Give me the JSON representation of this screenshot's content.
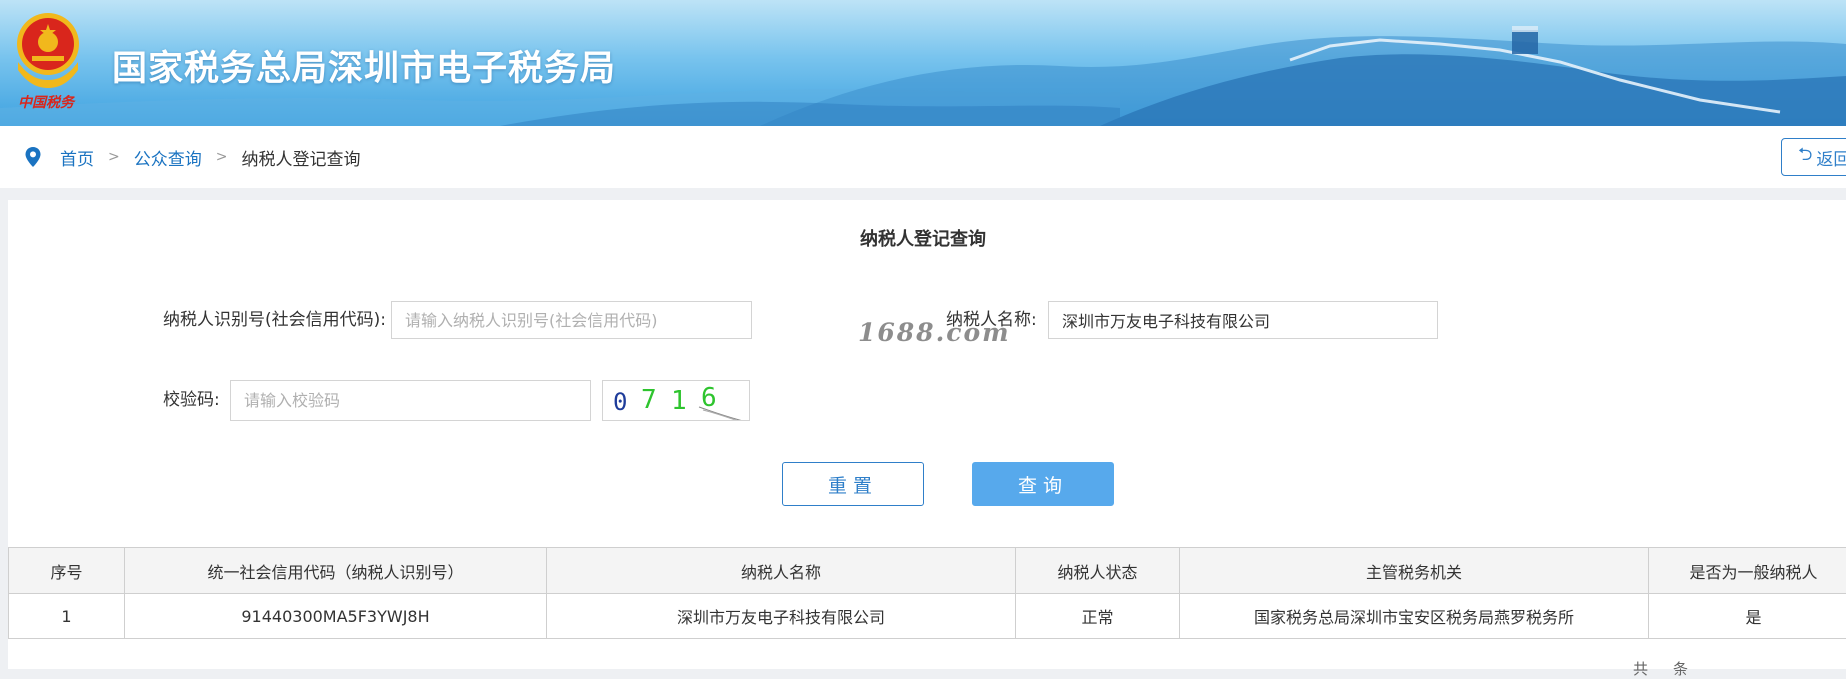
{
  "header": {
    "emblem_caption": "中国税务",
    "site_title": "国家税务总局深圳市电子税务局"
  },
  "breadcrumb": {
    "items": [
      "首页",
      "公众查询"
    ],
    "current": "纳税人登记查询",
    "separator": ">"
  },
  "back_button": {
    "label": "返回"
  },
  "form": {
    "title": "纳税人登记查询",
    "taxpayer_id": {
      "label": "纳税人识别号(社会信用代码):",
      "placeholder": "请输入纳税人识别号(社会信用代码)",
      "value": ""
    },
    "taxpayer_name": {
      "label": "纳税人名称:",
      "placeholder": "",
      "value": "深圳市万友电子科技有限公司"
    },
    "captcha": {
      "label": "校验码:",
      "placeholder": "请输入校验码",
      "value": "",
      "image_text": "0716"
    },
    "reset_label": "重置",
    "query_label": "查询"
  },
  "watermark": "1688.com",
  "table": {
    "columns": [
      "序号",
      "统一社会信用代码（纳税人识别号）",
      "纳税人名称",
      "纳税人状态",
      "主管税务机关",
      "是否为一般纳税人"
    ],
    "rows": [
      [
        "1",
        "91440300MA5F3YWJ8H",
        "深圳市万友电子科技有限公司",
        "正常",
        "国家税务总局深圳市宝安区税务局燕罗税务所",
        "是"
      ]
    ]
  },
  "pager": {
    "total_prefix": "共",
    "unit": "条"
  },
  "colors": {
    "accent": "#2f7fc9",
    "query_button": "#57a9ec",
    "emblem_red": "#d9261c",
    "emblem_gold": "#f1b81c"
  }
}
